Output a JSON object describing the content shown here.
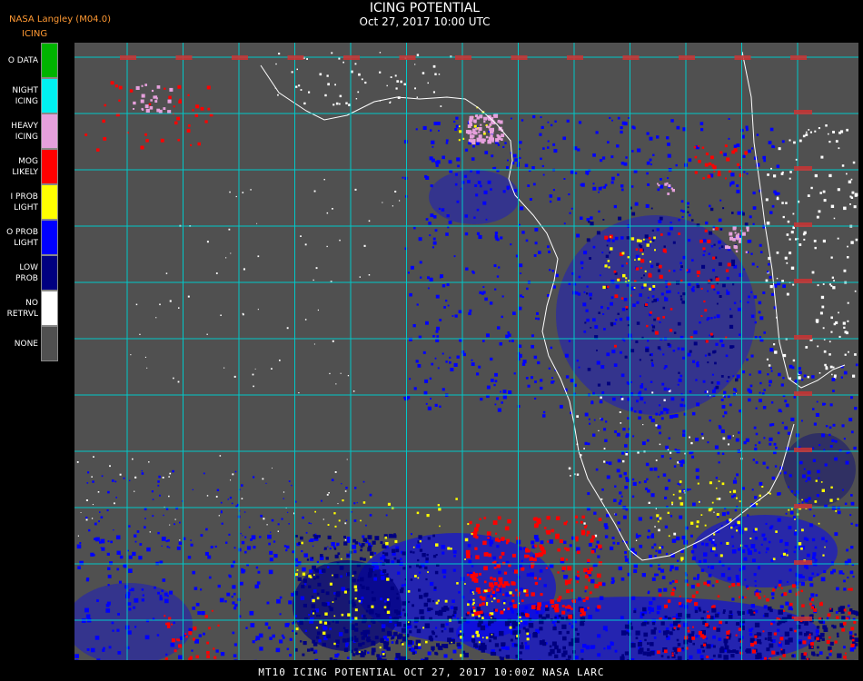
{
  "header": {
    "organization": "NASA Langley (M04.0)",
    "product": "ICING",
    "title": "ICING POTENTIAL",
    "subtitle": "Oct 27, 2017 10:00 UTC"
  },
  "legend": [
    {
      "label": "O DATA",
      "color": "#00b400"
    },
    {
      "label": "NIGHT\nICING",
      "color": "#00f0f0"
    },
    {
      "label": "HEAVY\nICING",
      "color": "#e6a0dc"
    },
    {
      "label": "MOG\nLIKELY",
      "color": "#ff0000"
    },
    {
      "label": "I PROB\nLIGHT",
      "color": "#ffff00"
    },
    {
      "label": "O PROB\nLIGHT",
      "color": "#0000ff"
    },
    {
      "label": "LOW\nPROB",
      "color": "#000080"
    },
    {
      "label": "NO\nRETRVL",
      "color": "#ffffff"
    },
    {
      "label": "NONE",
      "color": "#505050"
    }
  ],
  "map": {
    "background_color": "#505050",
    "grid_color": "#00c8c8",
    "coast_color": "#ffffff",
    "label_color": "#cc3333"
  },
  "footer": "MT10  ICING POTENTIAL   OCT 27, 2017 10:00Z   NASA LARC"
}
